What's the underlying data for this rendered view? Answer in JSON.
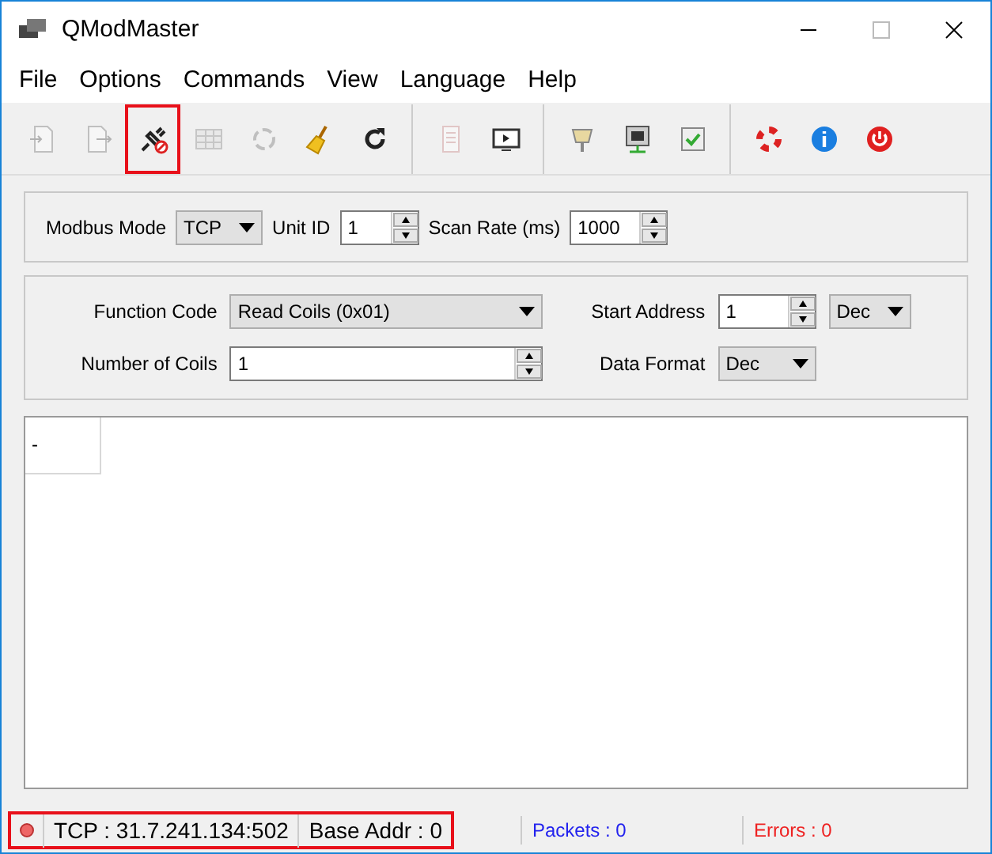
{
  "window": {
    "title": "QModMaster"
  },
  "menu": [
    "File",
    "Options",
    "Commands",
    "View",
    "Language",
    "Help"
  ],
  "toolbar": [
    [
      {
        "kind": "open",
        "disabled": true,
        "highlighted": false
      },
      {
        "kind": "save",
        "disabled": true,
        "highlighted": false
      },
      {
        "kind": "plug",
        "disabled": false,
        "highlighted": true
      },
      {
        "kind": "grid",
        "disabled": true,
        "highlighted": false
      },
      {
        "kind": "reset",
        "disabled": true,
        "highlighted": false
      },
      {
        "kind": "broom",
        "disabled": false,
        "highlighted": false
      },
      {
        "kind": "refresh",
        "disabled": false,
        "highlighted": false
      }
    ],
    [
      {
        "kind": "log",
        "disabled": true,
        "highlighted": false
      },
      {
        "kind": "monitor",
        "disabled": false,
        "highlighted": false
      }
    ],
    [
      {
        "kind": "serial",
        "disabled": false,
        "highlighted": false
      },
      {
        "kind": "network",
        "disabled": false,
        "highlighted": false
      },
      {
        "kind": "check",
        "disabled": false,
        "highlighted": false
      }
    ],
    [
      {
        "kind": "lifebuoy",
        "disabled": false,
        "highlighted": false
      },
      {
        "kind": "info",
        "disabled": false,
        "highlighted": false
      },
      {
        "kind": "power",
        "disabled": false,
        "highlighted": false
      }
    ]
  ],
  "connection": {
    "modbus_mode_label": "Modbus Mode",
    "modbus_mode": "TCP",
    "unit_id_label": "Unit ID",
    "unit_id": "1",
    "scan_rate_label": "Scan Rate (ms)",
    "scan_rate": "1000"
  },
  "request": {
    "function_code_label": "Function Code",
    "function_code": "Read Coils (0x01)",
    "start_address_label": "Start Address",
    "start_address": "1",
    "start_address_format": "Dec",
    "count_label": "Number of Coils",
    "count": "1",
    "data_format_label": "Data Format",
    "data_format": "Dec"
  },
  "table": {
    "cells": [
      "-"
    ]
  },
  "status_bar": {
    "connected": false,
    "connection": "TCP : 31.7.241.134:502",
    "base_addr": "Base Addr : 0",
    "packets": "Packets : 0",
    "errors": "Errors : 0",
    "highlighted": true
  }
}
